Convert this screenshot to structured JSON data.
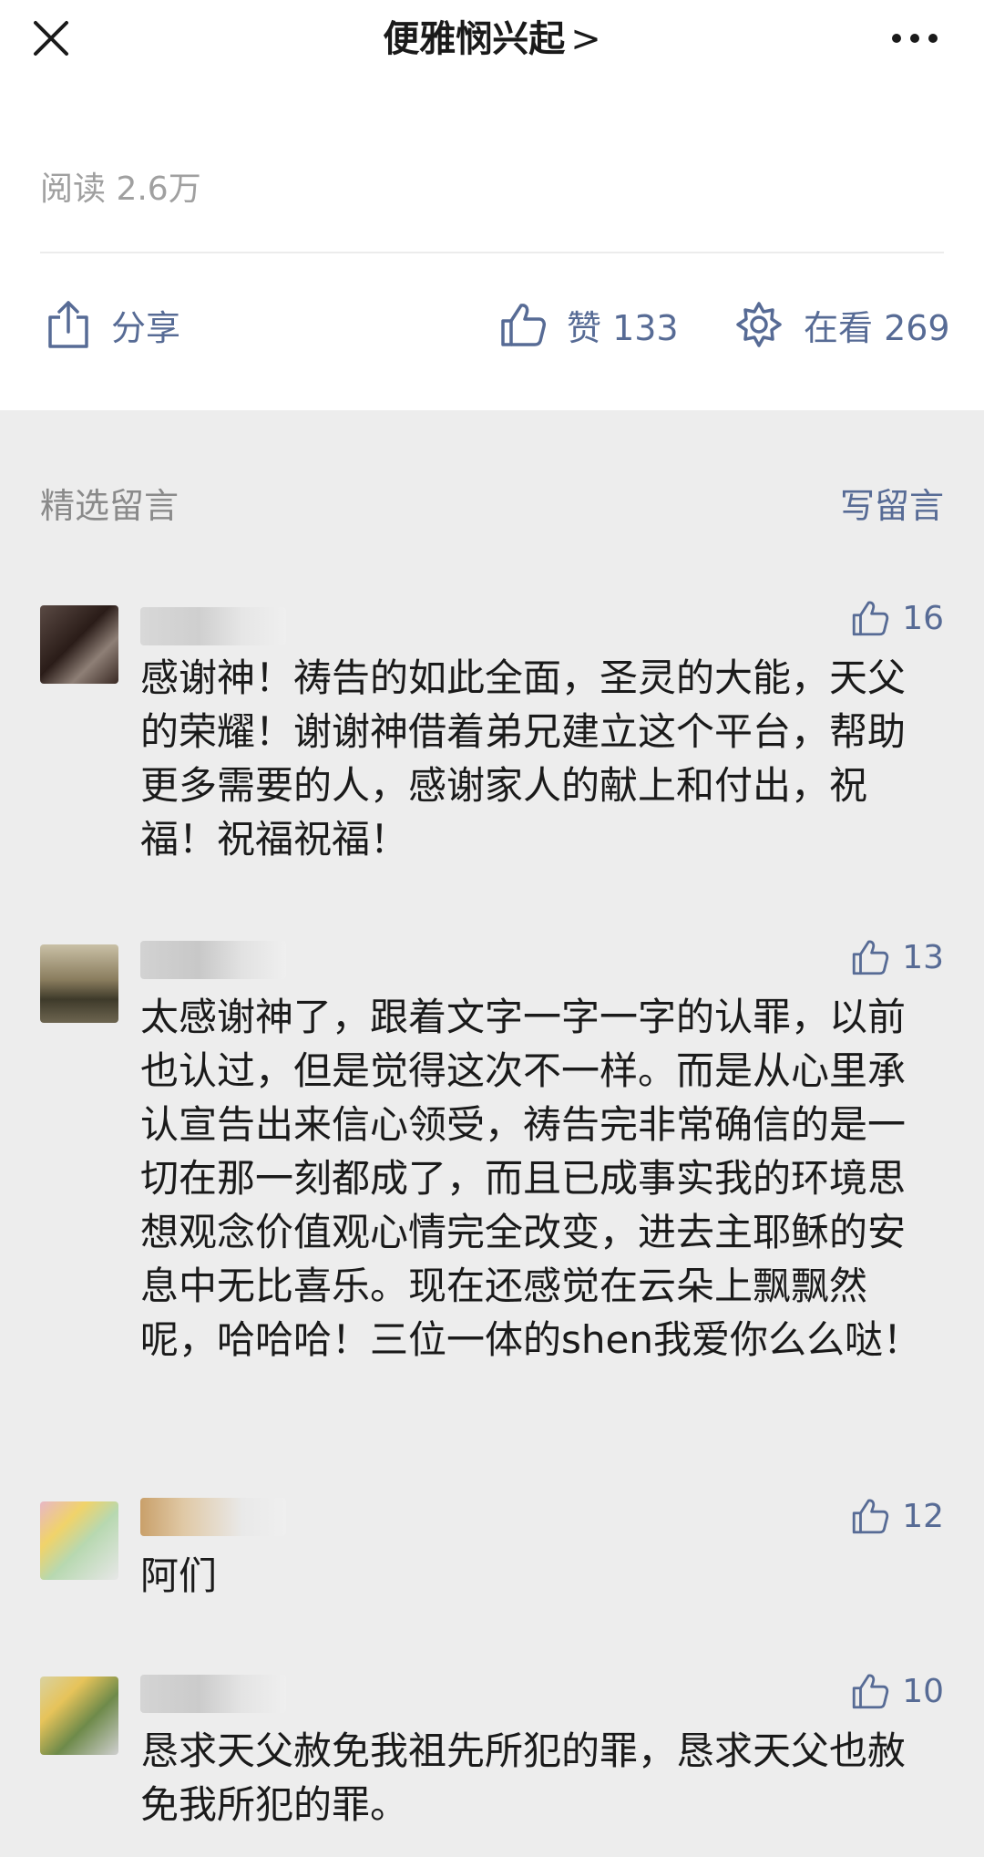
{
  "header": {
    "title": "便雅悯兴起",
    "chevron": ">",
    "close_icon": "close-icon",
    "more_icon": "more-dots-icon"
  },
  "article": {
    "read_count": "阅读 2.6万",
    "share_label": "分享",
    "like_label": "赞 133",
    "wow_label": "在看 269"
  },
  "comments_section": {
    "title": "精选留言",
    "write_label": "写留言"
  },
  "comments": [
    {
      "likes": "16",
      "text": "感谢神！祷告的如此全面，圣灵的大能，天父的荣耀！谢谢神借着弟兄建立这个平台，帮助更多需要的人，感谢家人的献上和付出，祝福！祝福祝福！"
    },
    {
      "likes": "13",
      "text": "太感谢神了，跟着文字一字一字的认罪，以前也认过，但是觉得这次不一样。而是从心里承认宣告出来信心领受，祷告完非常确信的是一切在那一刻都成了，而且已成事实我的环境思想观念价值观心情完全改变，进去主耶稣的安息中无比喜乐。现在还感觉在云朵上飘飘然呢，哈哈哈！三位一体的shen我爱你么么哒！"
    },
    {
      "likes": "12",
      "text": "阿们"
    },
    {
      "likes": "10",
      "text": "恳求天父赦免我祖先所犯的罪，恳求天父也赦免我所犯的罪。"
    }
  ],
  "colors": {
    "link": "#576b95",
    "muted": "#a0a0a0",
    "background": "#ededed"
  }
}
